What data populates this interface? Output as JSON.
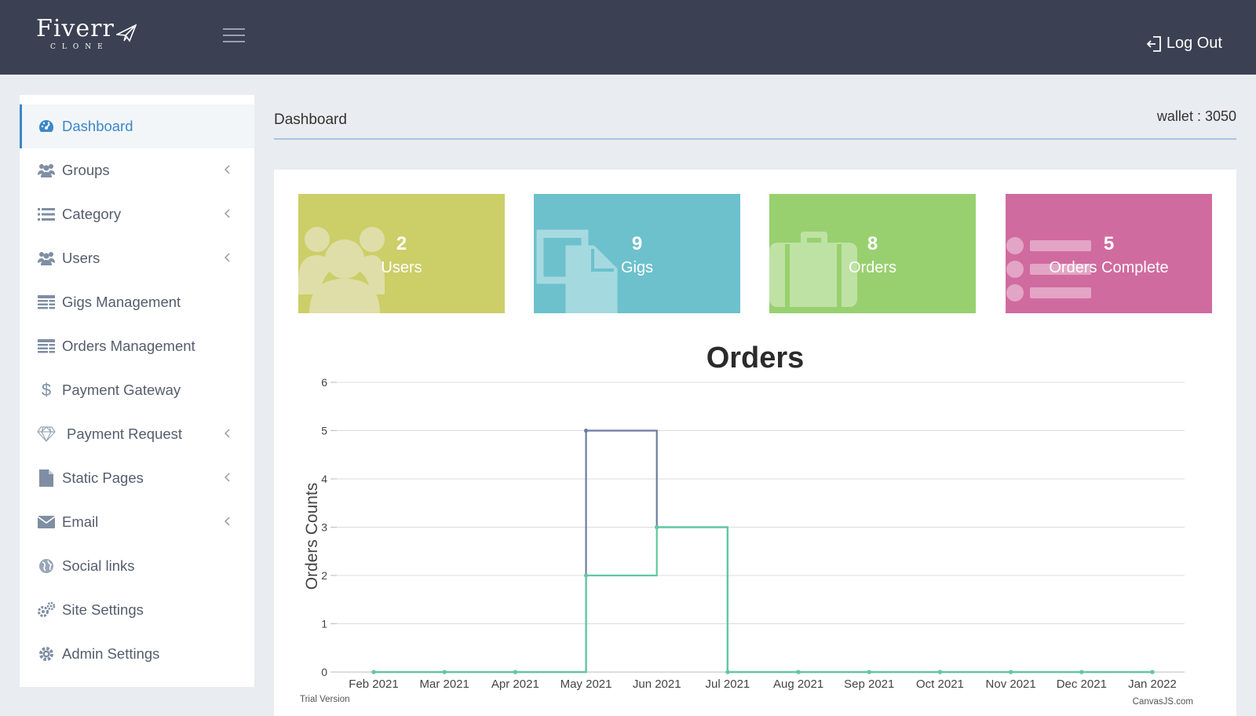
{
  "header": {
    "logo_main": "Fiverr",
    "logo_sub": "CLONE",
    "logout_label": "Log Out"
  },
  "sidebar": {
    "items": [
      {
        "label": "Dashboard",
        "icon": "dashboard-icon",
        "has_submenu": false,
        "active": true
      },
      {
        "label": "Groups",
        "icon": "users-icon",
        "has_submenu": true
      },
      {
        "label": "Category",
        "icon": "list-icon",
        "has_submenu": true
      },
      {
        "label": "Users",
        "icon": "users-icon",
        "has_submenu": true
      },
      {
        "label": "Gigs Management",
        "icon": "table-icon",
        "has_submenu": false
      },
      {
        "label": "Orders Management",
        "icon": "table-icon",
        "has_submenu": false
      },
      {
        "label": "Payment Gateway",
        "icon": "dollar-icon",
        "has_submenu": false
      },
      {
        "label": "Payment Request",
        "icon": "diamond-icon",
        "has_submenu": true
      },
      {
        "label": "Static Pages",
        "icon": "file-icon",
        "has_submenu": true
      },
      {
        "label": "Email",
        "icon": "envelope-icon",
        "has_submenu": true
      },
      {
        "label": "Social links",
        "icon": "globe-icon",
        "has_submenu": false
      },
      {
        "label": "Site Settings",
        "icon": "gears-icon",
        "has_submenu": false
      },
      {
        "label": "Admin Settings",
        "icon": "gear-icon",
        "has_submenu": false
      }
    ]
  },
  "main": {
    "page_title": "Dashboard",
    "wallet": "wallet : 3050"
  },
  "cards": [
    {
      "value": "2",
      "label": "Users",
      "color": "#ccce68",
      "icon": "users-icon"
    },
    {
      "value": "9",
      "label": "Gigs",
      "color": "#6cc1cc",
      "icon": "files-icon"
    },
    {
      "value": "8",
      "label": "Orders",
      "color": "#98d06f",
      "icon": "briefcase-icon"
    },
    {
      "value": "5",
      "label": "Orders Complete",
      "color": "#d06b9f",
      "icon": "list-icon"
    }
  ],
  "chart_data": {
    "type": "line",
    "step": true,
    "title": "Orders",
    "ylabel": "Orders Counts",
    "xlabel": "",
    "categories": [
      "Feb 2021",
      "Mar 2021",
      "Apr 2021",
      "May 2021",
      "Jun 2021",
      "Jul 2021",
      "Aug 2021",
      "Sep 2021",
      "Oct 2021",
      "Nov 2021",
      "Dec 2021",
      "Jan 2022"
    ],
    "ylim": [
      0,
      6
    ],
    "yticks": [
      0,
      1,
      2,
      3,
      4,
      5,
      6
    ],
    "grid": true,
    "series": [
      {
        "color": "#6e7aa3",
        "values": [
          0,
          0,
          0,
          5,
          3,
          0,
          0,
          0,
          0,
          0,
          0,
          0
        ]
      },
      {
        "color": "#5ec9a0",
        "values": [
          0,
          0,
          0,
          2,
          3,
          0,
          0,
          0,
          0,
          0,
          0,
          0
        ]
      }
    ],
    "watermark_left": "Trial Version",
    "watermark_right": "CanvasJS.com"
  }
}
